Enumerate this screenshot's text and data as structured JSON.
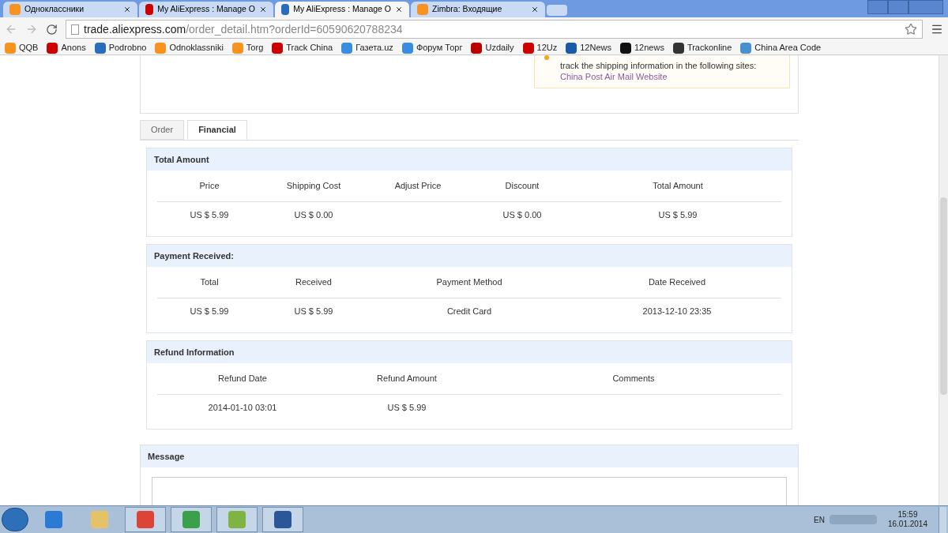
{
  "browser_tabs": [
    {
      "title": "Одноклассники",
      "selected": false
    },
    {
      "title": "My AliExpress : Manage O",
      "selected": false
    },
    {
      "title": "My AliExpress : Manage O",
      "selected": true
    },
    {
      "title": "Zimbra: Входящие",
      "selected": false
    }
  ],
  "address_bar": {
    "host": "trade.aliexpress.com",
    "path": "/order_detail.htm?orderId=60590620788234"
  },
  "bookmarks": [
    "QQB",
    "Anons",
    "Podrobno",
    "Odnoklassniki",
    "Torg",
    "Track China",
    "Газета.uz",
    "Форум Торг",
    "Uzdaily",
    "12Uz",
    "12News",
    "12news",
    "Trackonline",
    "China Area Code"
  ],
  "shipping_notice": {
    "text": "track the shipping information in the following sites:",
    "link": "China Post Air Mail Website"
  },
  "tabs": [
    {
      "label": "Order",
      "selected": false
    },
    {
      "label": "Financial",
      "selected": true
    }
  ],
  "sections": [
    {
      "title": "Total Amount",
      "columns": [
        "Price",
        "Shipping Cost",
        "Adjust Price",
        "Discount",
        "Total Amount"
      ],
      "rows": [
        [
          "US $ 5.99",
          "US $ 0.00",
          "",
          "US $ 0.00",
          "US $ 5.99"
        ]
      ]
    },
    {
      "title": "Payment Received:",
      "columns": [
        "Total",
        "Received",
        "Payment Method",
        "Date Received"
      ],
      "rows": [
        [
          "US $ 5.99",
          "US $ 5.99",
          "Credit Card",
          "2013-12-10 23:35"
        ]
      ]
    },
    {
      "title": "Refund Information",
      "columns": [
        "Refund Date",
        "Refund Amount",
        "Comments"
      ],
      "rows": [
        [
          "2014-01-10 03:01",
          "US $ 5.99",
          ""
        ]
      ]
    }
  ],
  "message": {
    "title": "Message"
  },
  "taskbar": {
    "language": "EN",
    "time": "15:59",
    "date": "16.01.2014"
  }
}
